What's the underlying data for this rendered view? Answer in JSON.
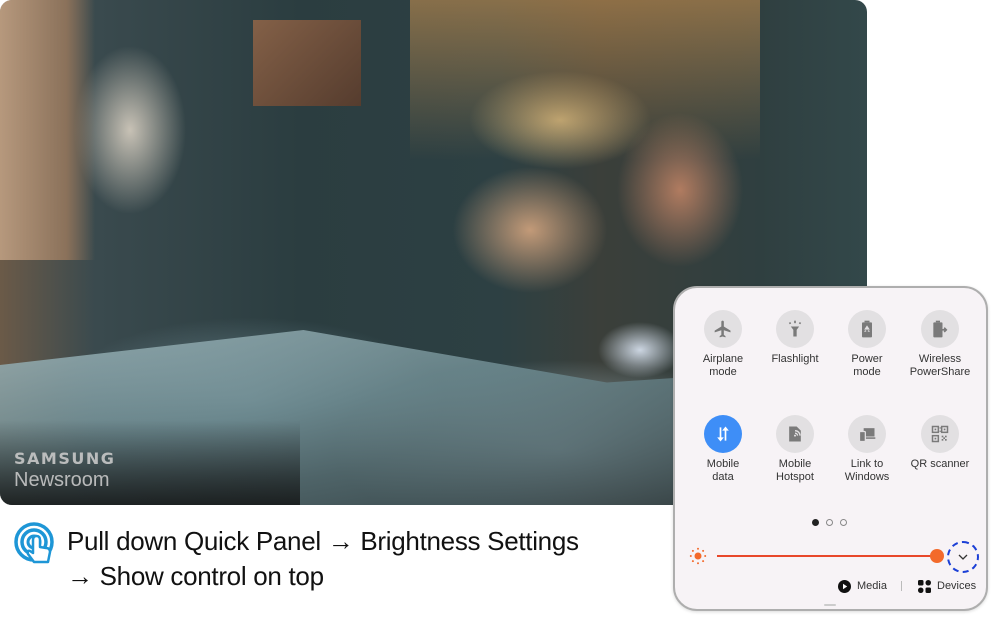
{
  "photo": {
    "alt": "Couple lying on a bed at night looking at a smartphone",
    "watermark": {
      "brand": "SAMSUNG",
      "sub": "Newsroom"
    }
  },
  "caption": {
    "icon": "tap-gesture-icon",
    "icon_color": "#1e96d6",
    "line1": "Pull down Quick Panel → Brightness Settings",
    "line2": "→ Show control on top"
  },
  "quick_panel": {
    "tiles": [
      {
        "label_1": "Airplane",
        "label_2": "mode",
        "icon": "airplane-icon",
        "active": false
      },
      {
        "label_1": "Flashlight",
        "label_2": "",
        "icon": "flashlight-icon",
        "active": false
      },
      {
        "label_1": "Power",
        "label_2": "mode",
        "icon": "power-mode-battery-icon",
        "active": false
      },
      {
        "label_1": "Wireless",
        "label_2": "PowerShare",
        "icon": "wireless-powershare-icon",
        "active": false
      },
      {
        "label_1": "Mobile",
        "label_2": "data",
        "icon": "mobile-data-arrows-icon",
        "active": true
      },
      {
        "label_1": "Mobile",
        "label_2": "Hotspot",
        "icon": "mobile-hotspot-icon",
        "active": false
      },
      {
        "label_1": "Link to",
        "label_2": "Windows",
        "icon": "link-to-windows-icon",
        "active": false
      },
      {
        "label_1": "QR scanner",
        "label_2": "",
        "icon": "qr-scanner-icon",
        "active": false
      }
    ],
    "page_indicator": {
      "total": 3,
      "current": 1
    },
    "brightness": {
      "level_percent": 100,
      "icon": "sun-icon",
      "color": "#f36a2b",
      "expand_icon": "chevron-down-icon"
    },
    "footer": {
      "media_label": "Media",
      "devices_label": "Devices"
    },
    "active_color": "#3e8ef7",
    "highlight_color": "#1b3fd6"
  }
}
